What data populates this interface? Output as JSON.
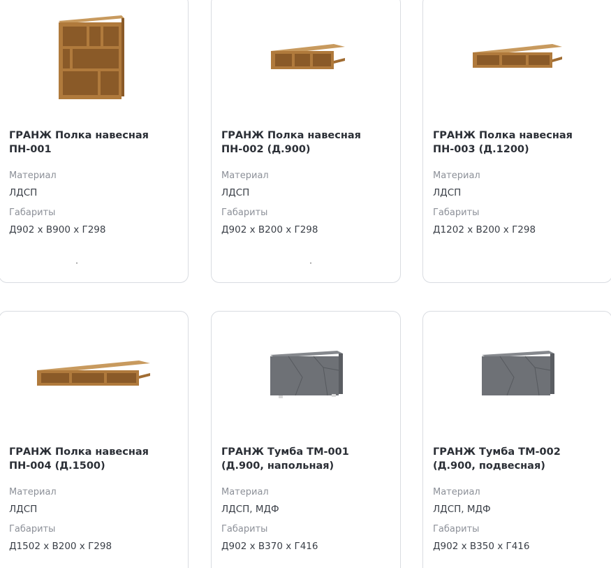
{
  "catalog": {
    "material_label": "Материал",
    "dimensions_label": "Габариты",
    "cards": [
      {
        "title": "ГРАНЖ Полка навесная ПН-001",
        "material": "ЛДСП",
        "dimensions": "Д902 х В900 х Г298",
        "image": "bookshelf-square"
      },
      {
        "title": "ГРАНЖ Полка навесная ПН-002 (Д.900)",
        "material": "ЛДСП",
        "dimensions": "Д902 х В200 х Г298",
        "image": "wall-shelf-900"
      },
      {
        "title": "ГРАНЖ Полка навесная ПН-003 (Д.1200)",
        "material": "ЛДСП",
        "dimensions": "Д1202 х В200 х Г298",
        "image": "wall-shelf-1200"
      },
      {
        "title": "ГРАНЖ Полка навесная ПН-004 (Д.1500)",
        "material": "ЛДСП",
        "dimensions": "Д1502 х В200 х Г298",
        "image": "wall-shelf-1500"
      },
      {
        "title": "ГРАНЖ Тумба ТМ-001 (Д.900, напольная)",
        "material": "ЛДСП, МДФ",
        "dimensions": "Д902 х В370 х Г416",
        "image": "tv-stand-floor"
      },
      {
        "title": "ГРАНЖ Тумба ТМ-002 (Д.900, подвесная)",
        "material": "ЛДСП, МДФ",
        "dimensions": "Д902 х В350 х Г416",
        "image": "tv-stand-wall"
      }
    ],
    "colors": {
      "wood": "#b07a3c",
      "wood_dark": "#8a5a28",
      "gray": "#6e7176",
      "border": "#d9dce1"
    }
  }
}
